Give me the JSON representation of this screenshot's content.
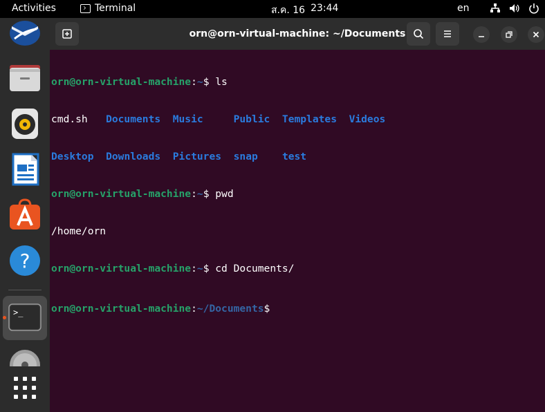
{
  "topbar": {
    "activities": "Activities",
    "app_name": "Terminal",
    "date": "ส.ค. 16",
    "time": "23:44",
    "lang": "en"
  },
  "dock": {
    "items": [
      "thunderbird-icon",
      "files-icon",
      "rhythmbox-icon",
      "writer-icon",
      "software-icon",
      "help-icon",
      "terminal-icon",
      "disc-icon",
      "apps-grid-icon"
    ]
  },
  "window": {
    "title": "orn@orn-virtual-machine: ~/Documents"
  },
  "terminal": {
    "prompt_user": "orn@orn-virtual-machine",
    "line1_path": "~",
    "line1_cmd": "$ ls",
    "ls_row1": [
      "cmd.sh",
      "Documents",
      "Music",
      "Public",
      "Templates",
      "Videos"
    ],
    "ls_row2": [
      "Desktop",
      "Downloads",
      "Pictures",
      "snap",
      "test"
    ],
    "line4_path": "~",
    "line4_cmd": "$ pwd",
    "pwd_output": "/home/orn",
    "line6_path": "~",
    "line6_cmd": "$ cd Documents/",
    "line7_path": "~/Documents",
    "line7_cmd": "$"
  },
  "colors": {
    "background": "#300a24",
    "prompt_green": "#26a269",
    "dir_blue": "#2a7bde",
    "accent": "#e95420"
  }
}
